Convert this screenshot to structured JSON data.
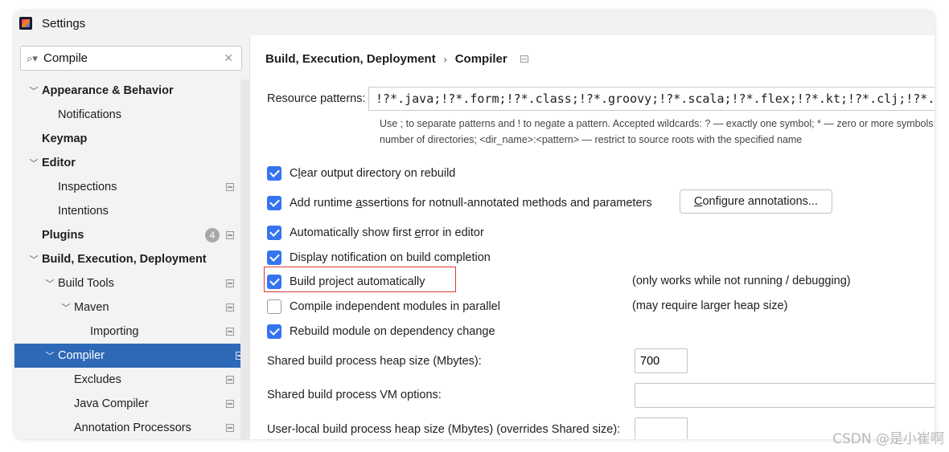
{
  "window": {
    "title": "Settings"
  },
  "search": {
    "value": "Compile"
  },
  "tree": [
    {
      "label": "Appearance & Behavior",
      "bold": true,
      "chevron": "down",
      "level": 0,
      "icon": false,
      "badge": null,
      "selected": false
    },
    {
      "label": "Notifications",
      "bold": false,
      "chevron": "",
      "level": 1,
      "icon": false,
      "badge": null,
      "selected": false
    },
    {
      "label": "Keymap",
      "bold": true,
      "chevron": "",
      "level": 0,
      "icon": false,
      "badge": null,
      "selected": false
    },
    {
      "label": "Editor",
      "bold": true,
      "chevron": "down",
      "level": 0,
      "icon": false,
      "badge": null,
      "selected": false
    },
    {
      "label": "Inspections",
      "bold": false,
      "chevron": "",
      "level": 1,
      "icon": true,
      "badge": null,
      "selected": false
    },
    {
      "label": "Intentions",
      "bold": false,
      "chevron": "",
      "level": 1,
      "icon": false,
      "badge": null,
      "selected": false
    },
    {
      "label": "Plugins",
      "bold": true,
      "chevron": "",
      "level": 0,
      "icon": true,
      "badge": "4",
      "selected": false
    },
    {
      "label": "Build, Execution, Deployment",
      "bold": true,
      "chevron": "down",
      "level": 0,
      "icon": false,
      "badge": null,
      "selected": false
    },
    {
      "label": "Build Tools",
      "bold": false,
      "chevron": "down",
      "level": 1,
      "icon": true,
      "badge": null,
      "selected": false
    },
    {
      "label": "Maven",
      "bold": false,
      "chevron": "down",
      "level": 2,
      "icon": true,
      "badge": null,
      "selected": false
    },
    {
      "label": "Importing",
      "bold": false,
      "chevron": "",
      "level": 3,
      "icon": true,
      "badge": null,
      "selected": false
    },
    {
      "label": "Compiler",
      "bold": false,
      "chevron": "down",
      "level": 1,
      "icon": true,
      "badge": null,
      "selected": true
    },
    {
      "label": "Excludes",
      "bold": false,
      "chevron": "",
      "level": 2,
      "icon": true,
      "badge": null,
      "selected": false
    },
    {
      "label": "Java Compiler",
      "bold": false,
      "chevron": "",
      "level": 2,
      "icon": true,
      "badge": null,
      "selected": false
    },
    {
      "label": "Annotation Processors",
      "bold": false,
      "chevron": "",
      "level": 2,
      "icon": true,
      "badge": null,
      "selected": false
    }
  ],
  "breadcrumb": {
    "parent": "Build, Execution, Deployment",
    "separator": "›",
    "current": "Compiler"
  },
  "resource_patterns": {
    "label": "Resource patterns:",
    "value": "!?*.java;!?*.form;!?*.class;!?*.groovy;!?*.scala;!?*.flex;!?*.kt;!?*.clj;!?*.aj",
    "hint_line1": "Use ; to separate patterns and ! to negate a pattern. Accepted wildcards: ? — exactly one symbol; * — zero or more symbols; / — path separator; /**/ — any",
    "hint_line2": "number of directories; <dir_name>:<pattern> — restrict to source roots with the specified name"
  },
  "options": {
    "clear_output": {
      "pre": "C",
      "mnemonic": "l",
      "post": "ear output directory on rebuild",
      "checked": true
    },
    "runtime_assertions": {
      "pre": "Add runtime ",
      "mnemonic": "a",
      "post": "ssertions for notnull-annotated methods and parameters",
      "checked": true
    },
    "show_first_error": {
      "pre": "Automatically show first ",
      "mnemonic": "e",
      "post": "rror in editor",
      "checked": true
    },
    "display_notification": {
      "pre": "Display notification on build completion",
      "mnemonic": "",
      "post": "",
      "checked": true
    },
    "build_automatically": {
      "pre": "Build project automatically",
      "mnemonic": "",
      "post": "",
      "checked": true
    },
    "compile_parallel": {
      "pre": "Compile independent modules in parallel",
      "mnemonic": "",
      "post": "",
      "checked": false
    },
    "rebuild_on_dependency": {
      "pre": "Rebuild module on dependency change",
      "mnemonic": "",
      "post": "",
      "checked": true
    }
  },
  "configure_annotations": {
    "mnemonic": "C",
    "post": "onfigure annotations..."
  },
  "notes": {
    "build_automatically": "(only works while not running / debugging)",
    "compile_parallel": "(may require larger heap size)"
  },
  "heap_size": {
    "label": "Shared build process heap size (Mbytes):",
    "value": "700"
  },
  "vm_options": {
    "label": "Shared build process VM options:",
    "value": ""
  },
  "user_heap": {
    "label": "User-local build process heap size (Mbytes) (overrides Shared size):",
    "value": ""
  },
  "watermark": "CSDN @是小崔啊",
  "colors": {
    "selection": "#2e69b8",
    "checkbox": "#3574f0",
    "highlight": "#e33a3a"
  }
}
